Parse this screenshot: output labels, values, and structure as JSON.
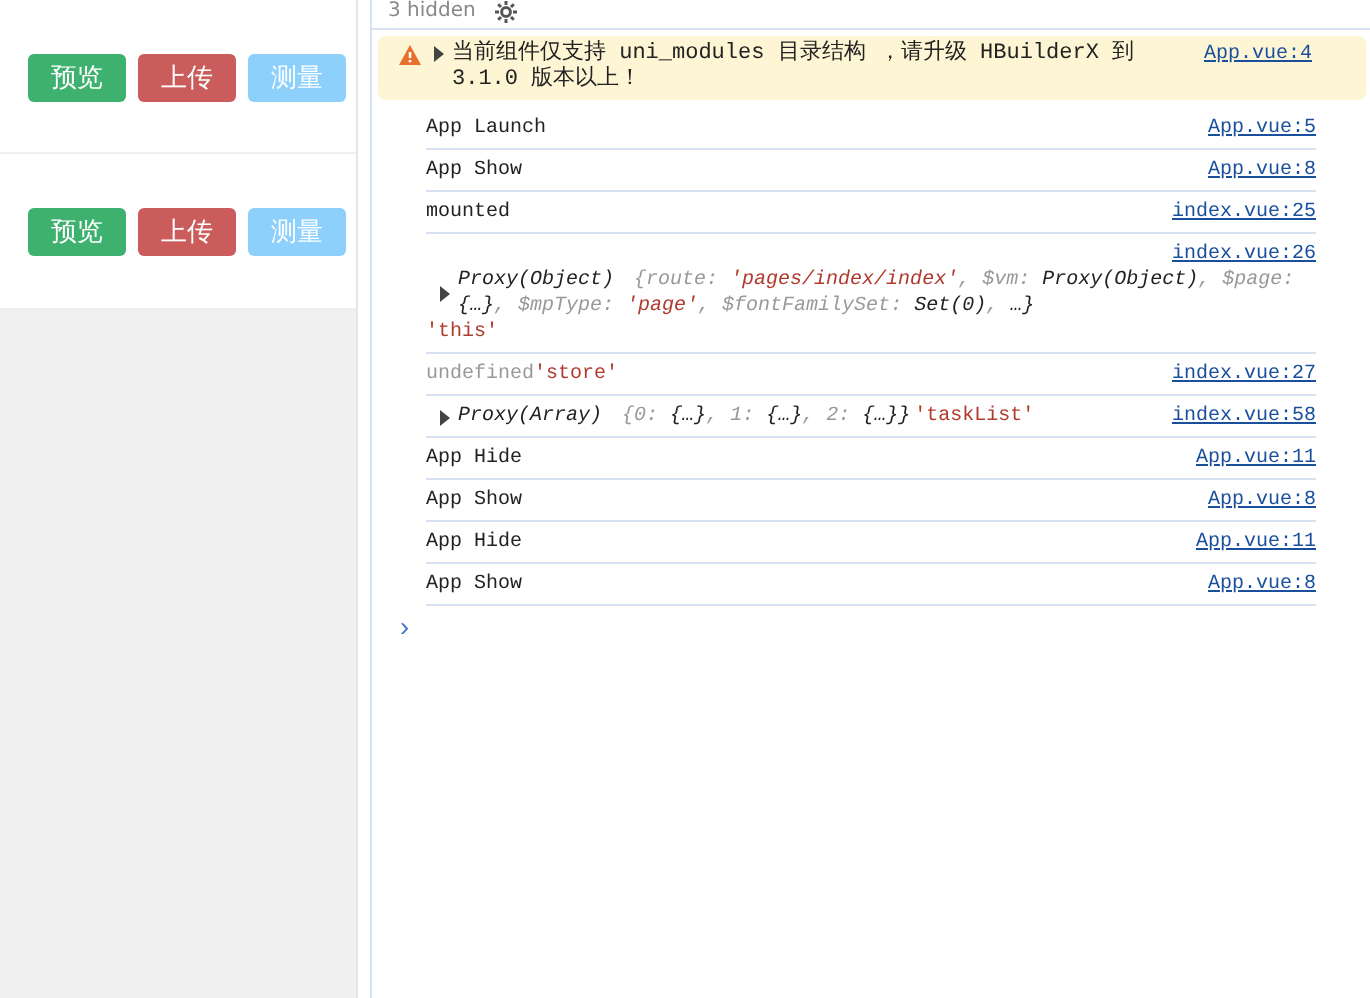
{
  "preview_list": {
    "rows": [
      {
        "buttons": [
          {
            "label": "预览",
            "kind": "preview"
          },
          {
            "label": "上传",
            "kind": "upload"
          },
          {
            "label": "测量",
            "kind": "measure"
          }
        ]
      },
      {
        "buttons": [
          {
            "label": "预览",
            "kind": "preview"
          },
          {
            "label": "上传",
            "kind": "upload"
          },
          {
            "label": "测量",
            "kind": "measure"
          }
        ]
      }
    ]
  },
  "console": {
    "hidden_count": "3 hidden",
    "entries": [
      {
        "kind": "warning",
        "expanded": false,
        "text": "当前组件仅支持 uni_modules 目录结构 ，请升级 HBuilderX 到 3.1.0 版本以上！",
        "source": "App.vue:4"
      },
      {
        "kind": "log",
        "text": "App Launch",
        "source": "App.vue:5"
      },
      {
        "kind": "log",
        "text": "App Show",
        "source": "App.vue:8"
      },
      {
        "kind": "log",
        "text": "mounted",
        "source": "index.vue:25"
      },
      {
        "kind": "object",
        "expanded": false,
        "summary": "Proxy(Object)",
        "tokens": [
          {
            "text": "{",
            "kind": "punct"
          },
          {
            "text": "route: ",
            "kind": "key"
          },
          {
            "text": "'pages/index/index'",
            "kind": "string"
          },
          {
            "text": ", $vm: ",
            "kind": "key"
          },
          {
            "text": "Proxy(Object)",
            "kind": "value"
          },
          {
            "text": ", $page: ",
            "kind": "key"
          },
          {
            "text": "{…}",
            "kind": "value"
          },
          {
            "text": ", $mpType: ",
            "kind": "key"
          },
          {
            "text": "'page'",
            "kind": "string"
          },
          {
            "text": ", $fontFamilySet: ",
            "kind": "key"
          },
          {
            "text": "Set(0)",
            "kind": "value"
          },
          {
            "text": ", ",
            "kind": "key"
          },
          {
            "text": " …}",
            "kind": "value"
          }
        ],
        "label": "'this'",
        "source": "index.vue:26"
      },
      {
        "kind": "undefined",
        "text": "undefined",
        "label": "'store'",
        "source": "index.vue:27"
      },
      {
        "kind": "array",
        "expanded": false,
        "summary": "Proxy(Array)",
        "tokens": [
          {
            "text": "{",
            "kind": "punct"
          },
          {
            "text": "0: ",
            "kind": "key"
          },
          {
            "text": "{…}",
            "kind": "value"
          },
          {
            "text": ", 1: ",
            "kind": "key"
          },
          {
            "text": "{…}",
            "kind": "value"
          },
          {
            "text": ", 2: ",
            "kind": "key"
          },
          {
            "text": "{…}}",
            "kind": "value"
          }
        ],
        "label": "'taskList'",
        "source": "index.vue:58"
      },
      {
        "kind": "log",
        "text": "App Hide",
        "source": "App.vue:11"
      },
      {
        "kind": "log",
        "text": "App Show",
        "source": "App.vue:8"
      },
      {
        "kind": "log",
        "text": "App Hide",
        "source": "App.vue:11"
      },
      {
        "kind": "log",
        "text": "App Show",
        "source": "App.vue:8"
      }
    ],
    "prompt": "›"
  }
}
